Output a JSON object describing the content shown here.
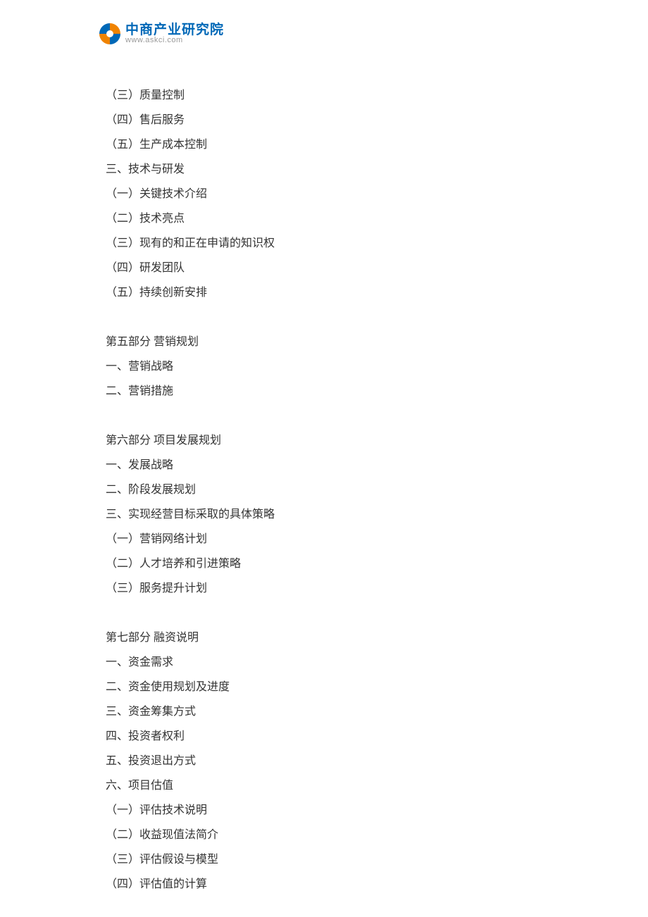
{
  "header": {
    "logo_text_main": "中商产业研究院",
    "logo_text_sub": "www.askci.com"
  },
  "toc": {
    "items": [
      {
        "text": "（三）质量控制",
        "type": "line"
      },
      {
        "text": "（四）售后服务",
        "type": "line"
      },
      {
        "text": "（五）生产成本控制",
        "type": "line"
      },
      {
        "text": "三、技术与研发",
        "type": "line"
      },
      {
        "text": "（一）关键技术介绍",
        "type": "line"
      },
      {
        "text": "（二）技术亮点",
        "type": "line"
      },
      {
        "text": "（三）现有的和正在申请的知识权",
        "type": "line"
      },
      {
        "text": "（四）研发团队",
        "type": "line"
      },
      {
        "text": "（五）持续创新安排",
        "type": "line"
      },
      {
        "text": "",
        "type": "spacer"
      },
      {
        "text": "第五部分  营销规划",
        "type": "section"
      },
      {
        "text": "一、营销战略",
        "type": "line"
      },
      {
        "text": "二、营销措施",
        "type": "line"
      },
      {
        "text": "",
        "type": "spacer"
      },
      {
        "text": "第六部分  项目发展规划",
        "type": "section"
      },
      {
        "text": "一、发展战略",
        "type": "line"
      },
      {
        "text": "二、阶段发展规划",
        "type": "line"
      },
      {
        "text": "三、实现经营目标采取的具体策略",
        "type": "line"
      },
      {
        "text": "（一）营销网络计划",
        "type": "line"
      },
      {
        "text": "（二）人才培养和引进策略",
        "type": "line"
      },
      {
        "text": "（三）服务提升计划",
        "type": "line"
      },
      {
        "text": "",
        "type": "spacer"
      },
      {
        "text": "第七部分  融资说明",
        "type": "section"
      },
      {
        "text": "一、资金需求",
        "type": "line"
      },
      {
        "text": "二、资金使用规划及进度",
        "type": "line"
      },
      {
        "text": "三、资金筹集方式",
        "type": "line"
      },
      {
        "text": "四、投资者权利",
        "type": "line"
      },
      {
        "text": "五、投资退出方式",
        "type": "line"
      },
      {
        "text": "六、项目估值",
        "type": "line"
      },
      {
        "text": "（一）评估技术说明",
        "type": "line"
      },
      {
        "text": "（二）收益现值法简介",
        "type": "line"
      },
      {
        "text": "（三）评估假设与模型",
        "type": "line"
      },
      {
        "text": "（四）评估值的计算",
        "type": "line"
      }
    ]
  }
}
